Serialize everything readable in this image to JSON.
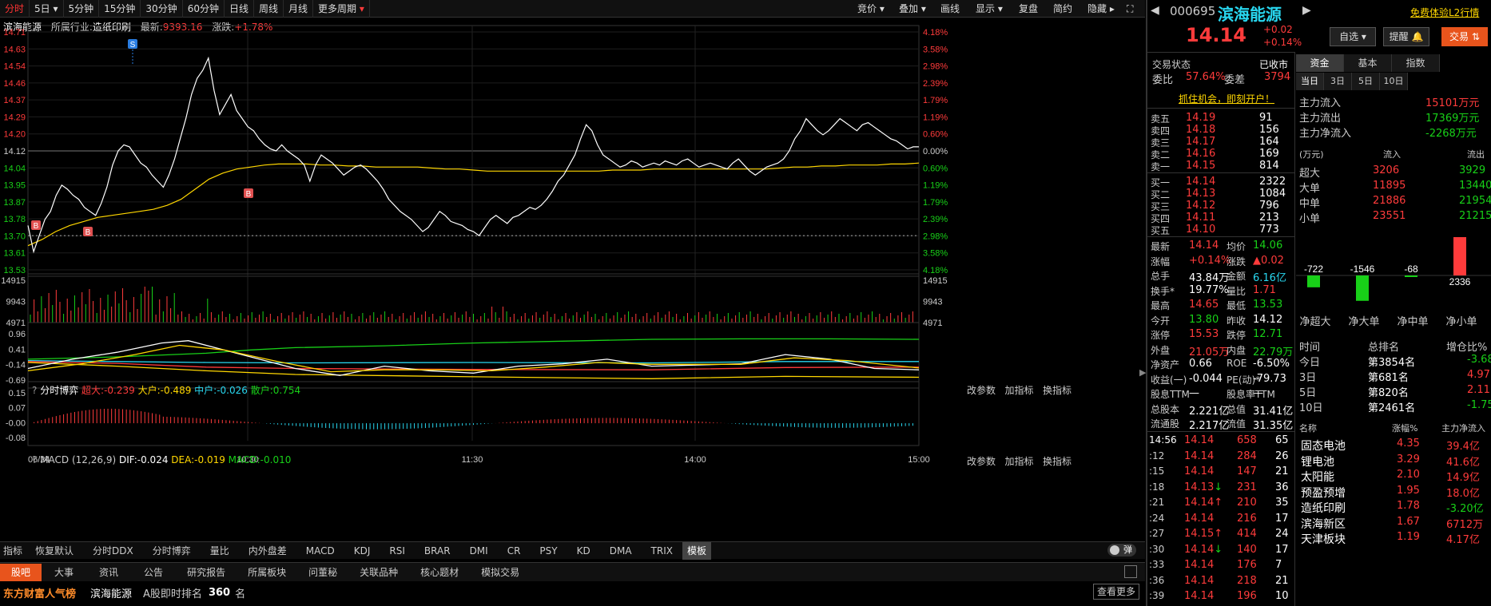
{
  "toolbar": {
    "items": [
      "分时",
      "5日",
      "5分钟",
      "15分钟",
      "30分钟",
      "60分钟",
      "日线",
      "周线",
      "月线",
      "更多周期"
    ],
    "right": [
      "竞价",
      "叠加",
      "画线",
      "显示",
      "复盘",
      "简约",
      "隐藏"
    ]
  },
  "header": {
    "name": "滨海能源",
    "industry_label": "所属行业:",
    "industry": "造纸印刷",
    "latest_label": "最新:",
    "latest": "9393.16",
    "change_label": "涨跌:",
    "change": "+1.78%"
  },
  "chart_data": [
    {
      "type": "line",
      "title": "",
      "y_left_ticks": [
        "14.71",
        "14.63",
        "14.54",
        "14.46",
        "14.37",
        "14.29",
        "14.20",
        "14.12",
        "14.04",
        "13.95",
        "13.87",
        "13.78",
        "13.70",
        "13.61",
        "13.53"
      ],
      "y_right_ticks": [
        "4.18%",
        "3.58%",
        "2.98%",
        "2.39%",
        "1.79%",
        "1.19%",
        "0.60%",
        "0.00%",
        "0.60%",
        "1.19%",
        "1.79%",
        "2.39%",
        "2.98%",
        "3.58%",
        "4.18%"
      ],
      "ylim": [
        13.53,
        14.71
      ],
      "x_ticks": [
        "06/24",
        "10:30",
        "11:30",
        "14:00",
        "15:00"
      ],
      "markers": [
        "S",
        "B",
        "B",
        "B"
      ],
      "series": [
        {
          "values": [
            13.75,
            13.62,
            13.7,
            13.78,
            13.82,
            13.9,
            13.95,
            13.93,
            13.9,
            13.88,
            13.84,
            13.82,
            13.8,
            13.86,
            13.94,
            14.05,
            14.12,
            14.15,
            14.14,
            14.1,
            14.06,
            14.04,
            14.0,
            13.97,
            13.94,
            14.0,
            14.08,
            14.18,
            14.28,
            14.4,
            14.48,
            14.52,
            14.58,
            14.42,
            14.3,
            14.35,
            14.4,
            14.32,
            14.28,
            14.24,
            14.22,
            14.18,
            14.15,
            14.13,
            14.12,
            14.15,
            14.12,
            14.1,
            14.08,
            14.05,
            13.97,
            14.05,
            14.1,
            14.08,
            14.06,
            14.03,
            14.0,
            14.02,
            14.04,
            14.05,
            14.03,
            14.0,
            13.97,
            13.93,
            13.88,
            13.85,
            13.82,
            13.8,
            13.78,
            13.75,
            13.72,
            13.74,
            13.78,
            13.82,
            13.8,
            13.77,
            13.76,
            13.75,
            13.73,
            13.72,
            13.7,
            13.74,
            13.78,
            13.8,
            13.78,
            13.76,
            13.79,
            13.8,
            13.82,
            13.84,
            13.83,
            13.85,
            13.88,
            13.92,
            13.97,
            14.0,
            14.05,
            14.1,
            14.18,
            14.25,
            14.22,
            14.15,
            14.1,
            14.08,
            14.06,
            14.04,
            14.05,
            14.07,
            14.06,
            14.04,
            14.05,
            14.06,
            14.05,
            14.07,
            14.06,
            14.05,
            14.07,
            14.08,
            14.06,
            14.04,
            14.05,
            14.06,
            14.05,
            14.04,
            14.03,
            14.06,
            14.08,
            14.05,
            14.02,
            14.0,
            14.02,
            14.04,
            14.05,
            14.06,
            14.08,
            14.12,
            14.18,
            14.22,
            14.28,
            14.25,
            14.22,
            14.2,
            14.22,
            14.25,
            14.28,
            14.26,
            14.24,
            14.22,
            14.25,
            14.26,
            14.24,
            14.22,
            14.2,
            14.18,
            14.17,
            14.15,
            14.13,
            14.14,
            14.14
          ]
        },
        {
          "values": [
            13.65,
            13.68,
            13.72,
            13.75,
            13.77,
            13.79,
            13.8,
            13.81,
            13.82,
            13.83,
            13.85,
            13.88,
            13.93,
            13.98,
            14.01,
            14.03,
            14.04,
            14.05,
            14.055,
            14.055,
            14.055,
            14.05,
            14.05,
            14.045,
            14.045,
            14.04,
            14.04,
            14.04,
            14.04,
            14.035,
            14.03,
            14.03,
            14.025,
            14.02,
            14.02,
            14.02,
            14.02,
            14.02,
            14.02,
            14.02,
            14.02,
            14.02,
            14.025,
            14.025,
            14.025,
            14.03,
            14.03,
            14.03,
            14.03,
            14.03,
            14.03,
            14.03,
            14.03,
            14.03,
            14.035,
            14.04,
            14.04,
            14.045,
            14.045,
            14.05,
            14.05,
            14.05,
            14.055,
            14.055,
            14.06
          ]
        }
      ]
    },
    {
      "type": "bar",
      "title": "",
      "y_ticks": [
        "14915",
        "9943",
        "4971"
      ]
    },
    {
      "type": "line",
      "title": "分时博弈",
      "y_ticks": [
        "0.96",
        "0.41",
        "-0.14",
        "-0.69"
      ],
      "legend": [
        {
          "name": "超大:-0.239",
          "color": "#ff3b3b"
        },
        {
          "name": "大户:-0.489",
          "color": "#ffd700"
        },
        {
          "name": "中户:-0.026",
          "color": "#28d7f0"
        },
        {
          "name": "散户:0.754",
          "color": "#18d018"
        }
      ]
    },
    {
      "type": "bar",
      "title": "MACD (12,26,9)",
      "y_ticks": [
        "0.15",
        "0.07",
        "-0.00",
        "-0.08"
      ],
      "legend": [
        {
          "name": "DIF:-0.024",
          "color": "#fff"
        },
        {
          "name": "DEA:-0.019",
          "color": "#ffd700"
        },
        {
          "name": "MACD:-0.010",
          "color": "#18d018"
        }
      ]
    }
  ],
  "subpanel": {
    "links": [
      "改参数",
      "加指标",
      "换指标"
    ]
  },
  "indicator_tabs": [
    "指标",
    "恢复默认",
    "分时DDX",
    "分时博弈",
    "量比",
    "内外盘差",
    "MACD",
    "KDJ",
    "RSI",
    "BRAR",
    "DMI",
    "CR",
    "PSY",
    "KD",
    "DMA",
    "TRIX",
    "模板"
  ],
  "bottom_tabs": [
    "股吧",
    "大事",
    "资讯",
    "公告",
    "研究报告",
    "所属板块",
    "问董秘",
    "关联品种",
    "核心题材",
    "模拟交易"
  ],
  "popularity": {
    "brand": "东方财富人气榜",
    "stock": "滨海能源",
    "label": "A股即时排名",
    "rank": "360",
    "unit": "名",
    "more": "查看更多"
  },
  "quote": {
    "code": "000695",
    "name": "滨海能源",
    "price": "14.14",
    "chg": "+0.02",
    "pct": "+0.14%",
    "free_l2": "免费体验L2行情",
    "watch": "自选",
    "remind": "提醒",
    "trade": "交易",
    "status_label": "交易状态",
    "status": "已收市",
    "wb_label": "委比",
    "wb": "57.64%",
    "wc_label": "委差",
    "wc": "3794",
    "ad": "抓住机会，即刻开户！"
  },
  "asks": [
    {
      "l": "卖五",
      "p": "14.19",
      "v": "91"
    },
    {
      "l": "卖四",
      "p": "14.18",
      "v": "156"
    },
    {
      "l": "卖三",
      "p": "14.17",
      "v": "164"
    },
    {
      "l": "卖二",
      "p": "14.16",
      "v": "169"
    },
    {
      "l": "卖一",
      "p": "14.15",
      "v": "814"
    }
  ],
  "bids": [
    {
      "l": "买一",
      "p": "14.14",
      "v": "2322"
    },
    {
      "l": "买二",
      "p": "14.13",
      "v": "1084"
    },
    {
      "l": "买三",
      "p": "14.12",
      "v": "796"
    },
    {
      "l": "买四",
      "p": "14.11",
      "v": "213"
    },
    {
      "l": "买五",
      "p": "14.10",
      "v": "773"
    }
  ],
  "stats": [
    [
      "最新",
      "14.14",
      "red",
      "均价",
      "14.06",
      "green"
    ],
    [
      "涨幅",
      "+0.14%",
      "red",
      "涨跌",
      "▲0.02",
      "red"
    ],
    [
      "总手",
      "43.84万",
      "white",
      "金额",
      "6.16亿",
      "cyan"
    ],
    [
      "换手*",
      "19.77%",
      "white",
      "量比",
      "1.71",
      "red"
    ],
    [
      "最高",
      "14.65",
      "red",
      "最低",
      "13.53",
      "green"
    ],
    [
      "今开",
      "13.80",
      "green",
      "昨收",
      "14.12",
      "white"
    ],
    [
      "涨停",
      "15.53",
      "red",
      "跌停",
      "12.71",
      "green"
    ],
    [
      "外盘",
      "21.05万",
      "red",
      "内盘",
      "22.79万",
      "green"
    ],
    [
      "净资产",
      "0.66",
      "white",
      "ROE",
      "-6.50%",
      "white"
    ],
    [
      "收益(一)",
      "-0.044",
      "white",
      "PE(动)*",
      "-79.73",
      "white"
    ],
    [
      "股息TTM",
      "—",
      "white",
      "股息率TTM",
      "—",
      "white"
    ],
    [
      "总股本",
      "2.221亿",
      "white",
      "总值",
      "31.41亿",
      "white"
    ],
    [
      "流通股",
      "2.217亿",
      "white",
      "流值",
      "31.35亿",
      "white"
    ]
  ],
  "trades": [
    [
      "14:56",
      "14.14",
      "658",
      "65",
      "red"
    ],
    [
      ":12",
      "14.14",
      "284",
      "26",
      "red"
    ],
    [
      ":15",
      "14.14",
      "147",
      "21",
      "red"
    ],
    [
      ":18",
      "14.13",
      "231",
      "36",
      "green",
      "down"
    ],
    [
      ":21",
      "14.14",
      "210",
      "35",
      "red",
      "up"
    ],
    [
      ":24",
      "14.14",
      "216",
      "17",
      "green"
    ],
    [
      ":27",
      "14.15",
      "414",
      "24",
      "red",
      "up"
    ],
    [
      ":30",
      "14.14",
      "140",
      "17",
      "red",
      "down"
    ],
    [
      ":33",
      "14.14",
      "176",
      "7",
      "green"
    ],
    [
      ":36",
      "14.14",
      "218",
      "21",
      "green"
    ],
    [
      ":39",
      "14.14",
      "196",
      "10",
      "green"
    ]
  ],
  "funds": {
    "tabs": [
      "资金",
      "基本",
      "指数"
    ],
    "periods": [
      "当日",
      "3日",
      "5日",
      "10日"
    ],
    "main": [
      [
        "主力流入",
        "15101万元",
        "red"
      ],
      [
        "主力流出",
        "17369万元",
        "green"
      ],
      [
        "主力净流入",
        "-2268万元",
        "green"
      ]
    ],
    "head": [
      "(万元)",
      "流入",
      "流出"
    ],
    "rows": [
      [
        "超大",
        "3206",
        "3929"
      ],
      [
        "大单",
        "11895",
        "13440"
      ],
      [
        "中单",
        "21886",
        "21954"
      ],
      [
        "小单",
        "23551",
        "21215"
      ]
    ],
    "net": {
      "values": [
        -722,
        -1546,
        -68,
        2336
      ],
      "labels": [
        "净超大",
        "净大单",
        "净中单",
        "净小单"
      ]
    }
  },
  "rank": {
    "head": [
      "时间",
      "总排名",
      "增仓比%"
    ],
    "rows": [
      [
        "今日",
        "第3854名",
        "-3.68",
        "green"
      ],
      [
        "3日",
        "第681名",
        "4.97",
        "red"
      ],
      [
        "5日",
        "第820名",
        "2.11",
        "red"
      ],
      [
        "10日",
        "第2461名",
        "-1.75",
        "green"
      ]
    ]
  },
  "sectors": {
    "head": [
      "名称",
      "涨幅%",
      "主力净流入"
    ],
    "rows": [
      [
        "固态电池",
        "4.35",
        "39.4亿",
        "red"
      ],
      [
        "锂电池",
        "3.29",
        "41.6亿",
        "red"
      ],
      [
        "太阳能",
        "2.10",
        "14.9亿",
        "red"
      ],
      [
        "预盈预增",
        "1.95",
        "18.0亿",
        "red"
      ],
      [
        "造纸印刷",
        "1.78",
        "-3.20亿",
        "green"
      ],
      [
        "滨海新区",
        "1.67",
        "6712万",
        "red"
      ],
      [
        "天津板块",
        "1.19",
        "4.17亿",
        "red"
      ]
    ]
  }
}
